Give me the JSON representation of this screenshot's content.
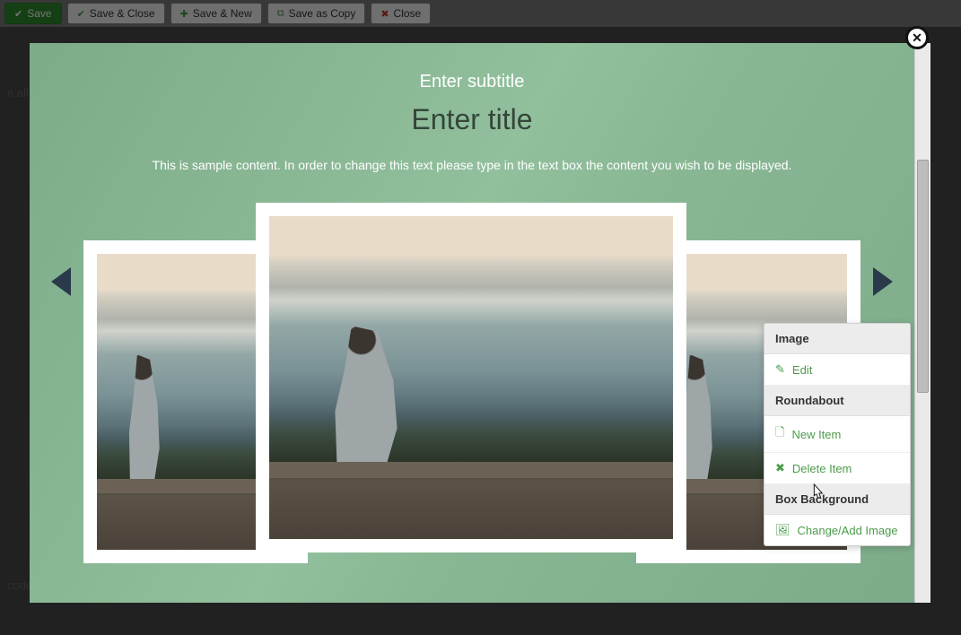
{
  "toolbar": {
    "save": "Save",
    "save_close": "Save & Close",
    "save_new": "Save & New",
    "save_copy": "Save as Copy",
    "close": "Close"
  },
  "bg_fragment_top": "e all",
  "bg_fragment_bottom": "code",
  "hero": {
    "subtitle": "Enter subtitle",
    "title": "Enter title",
    "desc": "This is sample content. In order to change this text please type in the text box the content you wish to be displayed."
  },
  "context": {
    "section_image": "Image",
    "edit": "Edit",
    "section_roundabout": "Roundabout",
    "new_item": "New Item",
    "delete_item": "Delete Item",
    "section_box_bg": "Box Background",
    "change_add_image": "Change/Add Image"
  }
}
